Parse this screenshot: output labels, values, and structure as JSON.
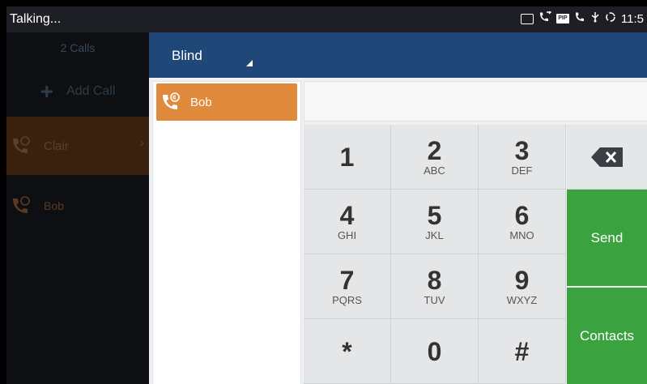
{
  "status_bar": {
    "title": "Talking...",
    "time": "11:5",
    "icons": [
      "image-icon",
      "call-transfer-icon",
      "pip-icon",
      "phone-icon",
      "usb-icon",
      "sync-icon"
    ],
    "pip_label": "PIP"
  },
  "call_list": {
    "calls_label": "2 Calls",
    "add_call_label": "Add Call",
    "items": [
      {
        "name": "Clair",
        "active": true
      },
      {
        "name": "Bob",
        "active": false
      }
    ]
  },
  "transfer": {
    "mode": "Blind",
    "contacts": [
      {
        "name": "Bob"
      }
    ],
    "number_value": "",
    "keypad": [
      {
        "digit": "1",
        "letters": ""
      },
      {
        "digit": "2",
        "letters": "ABC"
      },
      {
        "digit": "3",
        "letters": "DEF"
      },
      {
        "digit": "4",
        "letters": "GHI"
      },
      {
        "digit": "5",
        "letters": "JKL"
      },
      {
        "digit": "6",
        "letters": "MNO"
      },
      {
        "digit": "7",
        "letters": "PQRS"
      },
      {
        "digit": "8",
        "letters": "TUV"
      },
      {
        "digit": "9",
        "letters": "WXYZ"
      },
      {
        "digit": "*",
        "letters": ""
      },
      {
        "digit": "0",
        "letters": ""
      },
      {
        "digit": "#",
        "letters": ""
      }
    ],
    "send_label": "Send",
    "contacts_label": "Contacts",
    "backspace_icon": "backspace-icon"
  },
  "colors": {
    "header": "#1f4879",
    "selected_contact": "#e08a3b",
    "action_green": "#3aa23e",
    "status_bar": "#1d1f24"
  }
}
